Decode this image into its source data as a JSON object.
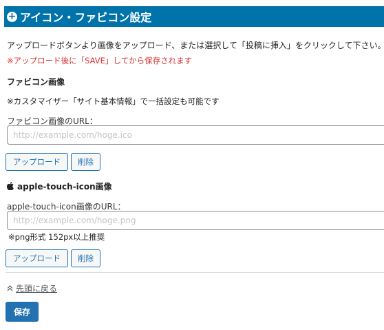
{
  "header": {
    "icon": "plus-circle-icon",
    "title": "アイコン・ファビコン設定"
  },
  "description": "アップロードボタンより画像をアップロード、または選択して「投稿に挿入」をクリックして下さい。",
  "warning": "※アップロード後に「SAVE」してから保存されます",
  "favicon": {
    "title": "ファビコン画像",
    "note": "※カスタマイザー「サイト基本情報」で一括設定も可能です",
    "url_label": "ファビコン画像のURL：",
    "url_value": "",
    "url_placeholder": "http://example.com/hoge.ico",
    "upload_label": "アップロード",
    "delete_label": "削除"
  },
  "apple_touch": {
    "icon": "apple-icon",
    "title": "apple-touch-icon画像",
    "url_label": "apple-touch-icon画像のURL：",
    "url_value": "",
    "url_placeholder": "http://example.com/hoge.png",
    "note": "※png形式 152px以上推奨",
    "upload_label": "アップロード",
    "delete_label": "削除"
  },
  "back_to_top": {
    "icon": "double-chevron-up-icon",
    "label": "先頭に戻る"
  },
  "save_label": "保存",
  "colors": {
    "header_bg": "#0073aa",
    "warning": "#dc3232",
    "button_primary": "#2271b1"
  }
}
